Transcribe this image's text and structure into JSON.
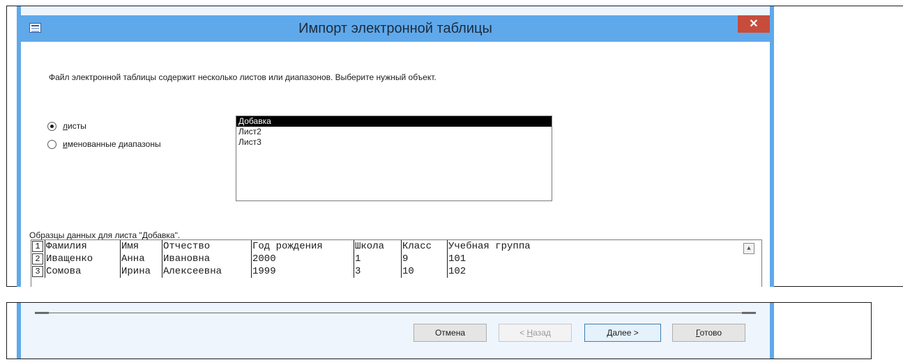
{
  "dialog": {
    "title": "Импорт электронной таблицы",
    "close_glyph": "✕",
    "prompt": "Файл электронной таблицы содержит несколько листов или диапазонов. Выберите нужный объект."
  },
  "options": {
    "sheets_label": "листы",
    "sheets_selected": true,
    "ranges_label": "именованные диапазоны",
    "ranges_selected": false
  },
  "sheet_list": {
    "items": [
      "Добавка",
      "Лист2",
      "Лист3"
    ],
    "selected_index": 0
  },
  "sample": {
    "label": "Образцы данных для листа \"Добавка\".",
    "rows": [
      {
        "num": "1",
        "cells": [
          "Фамилия",
          "Имя",
          "Отчество",
          "Год рождения",
          "Школа",
          "Класс",
          "Учебная группа"
        ]
      },
      {
        "num": "2",
        "cells": [
          "Иващенко",
          "Анна",
          "Ивановна",
          "2000",
          "1",
          "9",
          "101"
        ]
      },
      {
        "num": "3",
        "cells": [
          "Сомова",
          "Ирина",
          "Алексеевна",
          "1999",
          "3",
          "10",
          "102"
        ]
      }
    ]
  },
  "buttons": {
    "cancel": "Отмена",
    "back": "< Назад",
    "next": "Далее >",
    "finish": "Готово"
  },
  "colors": {
    "title_bar": "#5fa9eb",
    "close_button": "#c74c3c",
    "window_background": "#eef5fd"
  },
  "icons": {
    "app": "table-icon",
    "close": "close-icon",
    "scroll": "scroll-up-arrow-icon"
  }
}
